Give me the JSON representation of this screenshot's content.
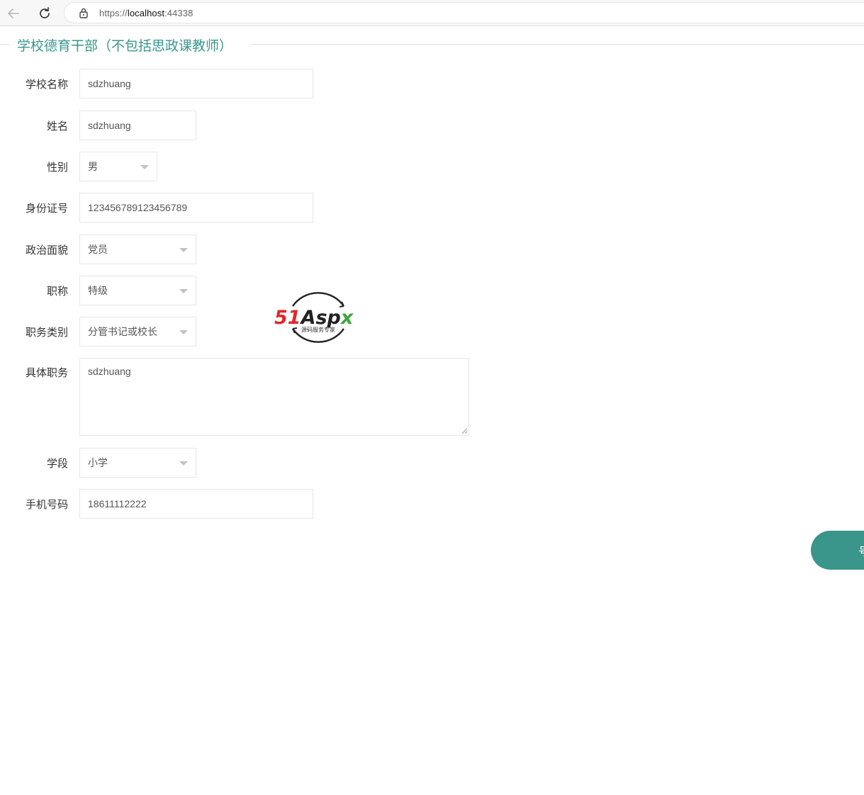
{
  "browser": {
    "url_prefix": "https://",
    "url_host": "localhost",
    "url_port": ":44338"
  },
  "page": {
    "section_title": "学校德育干部（不包括思政课教师）"
  },
  "form": {
    "school_name": {
      "label": "学校名称",
      "value": "sdzhuang"
    },
    "name": {
      "label": "姓名",
      "value": "sdzhuang"
    },
    "gender": {
      "label": "性别",
      "value": "男"
    },
    "id_number": {
      "label": "身份证号",
      "value": "123456789123456789"
    },
    "political_status": {
      "label": "政治面貌",
      "value": "党员"
    },
    "title": {
      "label": "职称",
      "value": "特级"
    },
    "duty_type": {
      "label": "职务类别",
      "value": "分管书记或校长"
    },
    "duty_detail": {
      "label": "具体职务",
      "value": "sdzhuang"
    },
    "school_stage": {
      "label": "学段",
      "value": "小学"
    },
    "phone": {
      "label": "手机号码",
      "value": "18611112222"
    }
  },
  "watermark": {
    "brand": "51Aspx",
    "brand_red": "51",
    "brand_dark": "Asp",
    "brand_green": "x",
    "tagline": "源码服务专家"
  },
  "actions": {
    "submit_label": "号"
  },
  "colors": {
    "accent": "#37978c",
    "button": "#3a958a",
    "logo_red": "#e3262b",
    "logo_green": "#3aa83c"
  }
}
